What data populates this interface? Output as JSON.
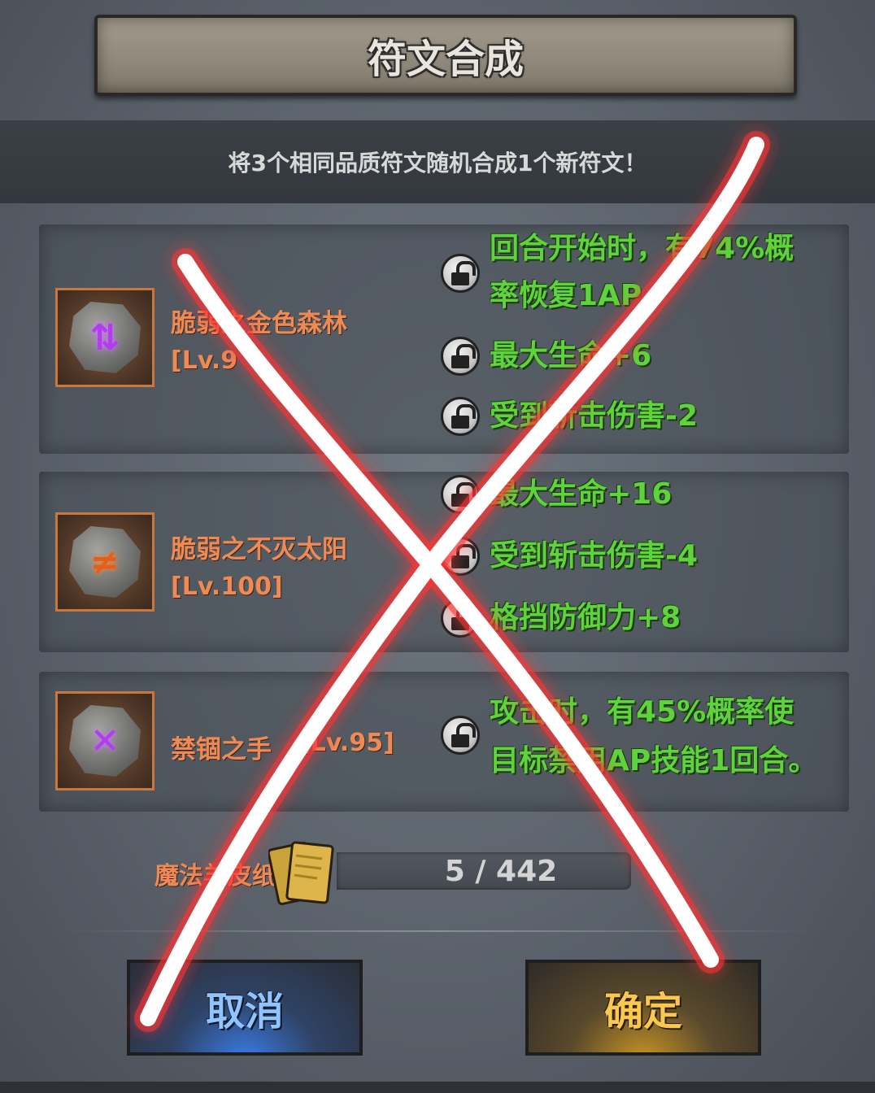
{
  "title": "符文合成",
  "info": "将3个相同品质符文随机合成1个新符文！",
  "runes": [
    {
      "name": "脆弱之金色森林",
      "level": "[Lv.9",
      "glyph": "⇅",
      "glyph_color": "purple",
      "stats": [
        "回合开始时，有74%概",
        "率恢复1AP",
        "最大生命+6",
        "受到斩击伤害-2"
      ]
    },
    {
      "name": "脆弱之不灭太阳",
      "level": "[Lv.100]",
      "glyph": "≠",
      "glyph_color": "orange",
      "stats": [
        "最大生命+16",
        "受到斩击伤害-4",
        "格挡防御力+8"
      ]
    },
    {
      "name": "禁锢之手",
      "level": "[Lv.95]",
      "glyph": "✕",
      "glyph_color": "purple",
      "stats": [
        "攻击时，有45%概率使",
        "目标禁用AP技能1回合。"
      ]
    }
  ],
  "resource": {
    "label": "魔法羊皮纸",
    "current": 5,
    "total": 442,
    "display": "5 / 442"
  },
  "buttons": {
    "cancel": "取消",
    "confirm": "确定"
  },
  "colors": {
    "rune_name": "#f08a55",
    "stat_text": "#5fd33c",
    "cancel_text": "#8fc4ff",
    "confirm_text": "#f8c850",
    "overlay_cross": "#ffffff",
    "overlay_glow": "#ff3030"
  },
  "icons": [
    "lock-open-icon",
    "rune-stone-icon",
    "parchment-icon",
    "cross-overlay"
  ]
}
